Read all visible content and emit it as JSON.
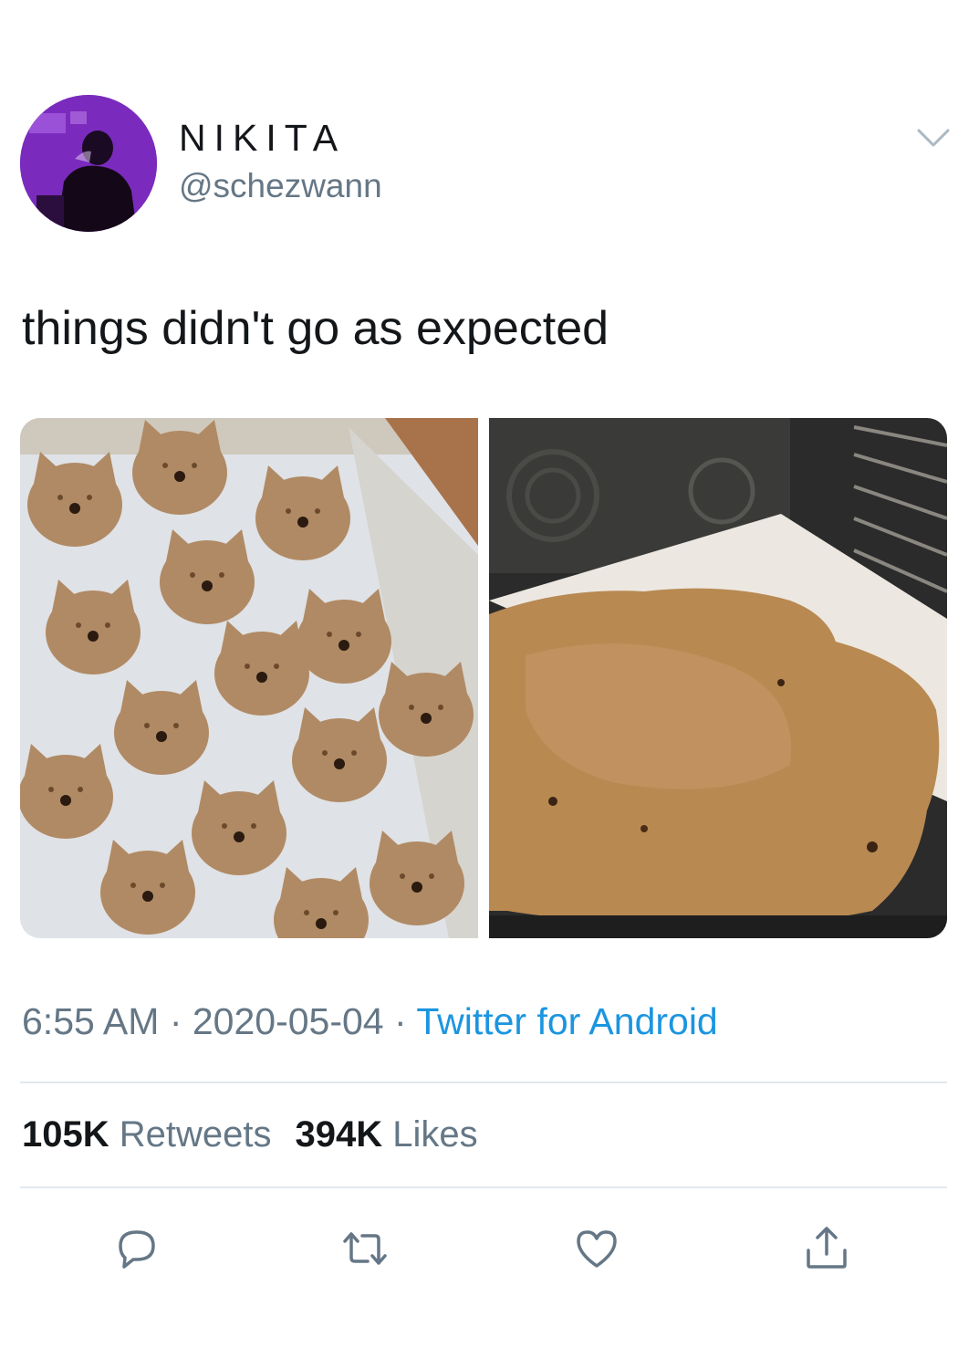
{
  "user": {
    "display_name": "NIKITA",
    "handle": "@schezwann",
    "avatar_icon": "profile-photo"
  },
  "tweet": {
    "text": "things didn't go as expected",
    "media": [
      {
        "name": "cat-shaped-cookies-before-baking"
      },
      {
        "name": "cookies-merged-after-baking"
      }
    ]
  },
  "meta": {
    "time": "6:55 AM",
    "sep1": " · ",
    "date": "2020-05-04",
    "sep2": " · ",
    "source": "Twitter for Android"
  },
  "stats": {
    "retweets_count": "105K",
    "retweets_label": "Retweets",
    "likes_count": "394K",
    "likes_label": "Likes"
  },
  "actions": [
    "reply-icon",
    "retweet-icon",
    "like-icon",
    "share-icon"
  ],
  "colors": {
    "text": "#14171a",
    "secondary": "#657786",
    "link": "#1b95e0",
    "divider": "#e1e8ed"
  }
}
